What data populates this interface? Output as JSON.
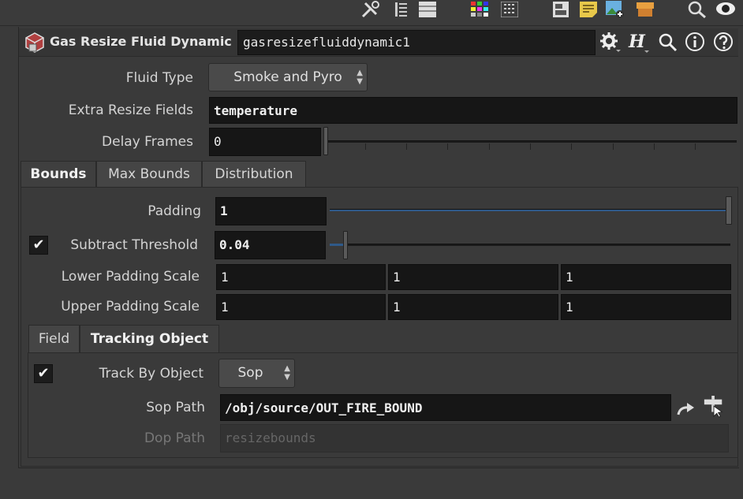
{
  "topbar": {
    "icons": [
      "tools-icon",
      "list-icon",
      "lines-icon",
      "color-grid-icon",
      "grid-list-icon",
      "layout-icon",
      "sticky-note-icon",
      "image-add-icon",
      "box-icon",
      "search-icon",
      "eye-icon"
    ]
  },
  "header": {
    "node_type": "Gas Resize Fluid Dynamic",
    "node_name": "gasresizefluiddynamic1",
    "icons": [
      "gear-icon",
      "help-h-icon",
      "search-icon",
      "info-icon",
      "question-icon"
    ]
  },
  "params": {
    "fluid_type_label": "Fluid Type",
    "fluid_type_value": "Smoke and Pyro",
    "extra_resize_fields_label": "Extra Resize Fields",
    "extra_resize_fields_value": "temperature",
    "delay_frames_label": "Delay Frames",
    "delay_frames_value": "0"
  },
  "tabs": [
    "Bounds",
    "Max Bounds",
    "Distribution"
  ],
  "bounds": {
    "padding_label": "Padding",
    "padding_value": "1",
    "padding_slider_fraction": 1.0,
    "subtract_threshold_checked": true,
    "subtract_threshold_label": "Subtract Threshold",
    "subtract_threshold_value": "0.04",
    "subtract_threshold_slider_fraction": 0.04,
    "lower_padding_scale_label": "Lower Padding Scale",
    "lower_padding_scale": [
      "1",
      "1",
      "1"
    ],
    "upper_padding_scale_label": "Upper Padding Scale",
    "upper_padding_scale": [
      "1",
      "1",
      "1"
    ]
  },
  "subtabs": [
    "Field",
    "Tracking Object"
  ],
  "tracking": {
    "track_by_object_checked": true,
    "track_by_object_label": "Track By Object",
    "track_by_object_value": "Sop",
    "sop_path_label": "Sop Path",
    "sop_path_value": "/obj/source/OUT_FIRE_BOUND",
    "dop_path_label": "Dop Path",
    "dop_path_placeholder": "resizebounds"
  },
  "check_glyph": "✔"
}
